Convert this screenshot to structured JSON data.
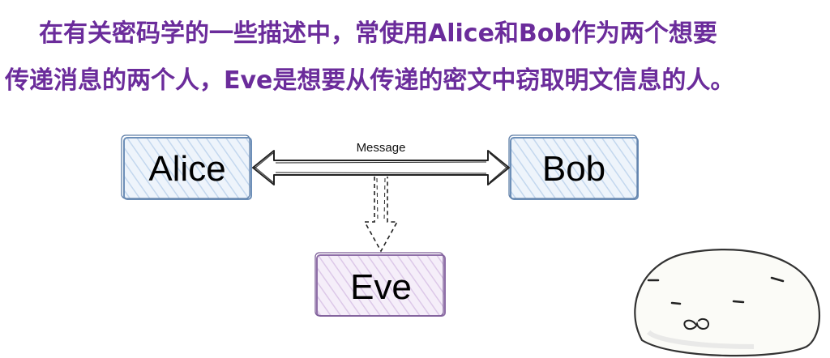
{
  "caption": {
    "line1": "在有关密码学的一些描述中，常使用Alice和Bob作为两个想要",
    "line2": "传递消息的两个人，Eve是想要从传递的密文中窃取明文信息的人。"
  },
  "diagram": {
    "nodes": {
      "alice": "Alice",
      "bob": "Bob",
      "eve": "Eve"
    },
    "edge_label": "Message"
  },
  "colors": {
    "caption": "#6b2c9b",
    "alice_border": "#6d8fb8",
    "alice_fill": "#cfe0f2",
    "bob_border": "#6d8fb8",
    "bob_fill": "#cfe0f2",
    "eve_border": "#8f6fa8",
    "eve_fill": "#e4d2ee"
  },
  "icons": {
    "mascot": "round-bun-face-icon"
  }
}
